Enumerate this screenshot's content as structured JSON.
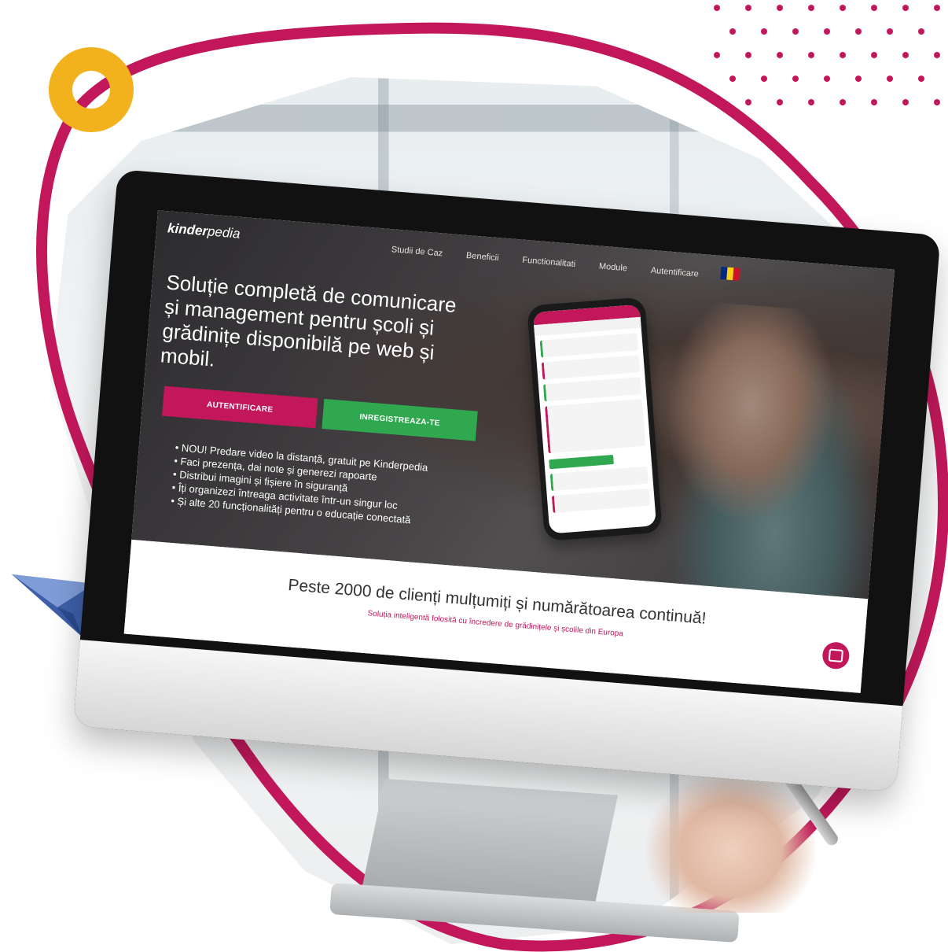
{
  "site": {
    "logo_bold": "kinder",
    "logo_light": "pedia",
    "nav": [
      "Studii de Caz",
      "Beneficii",
      "Functionalitati",
      "Module",
      "Autentificare"
    ],
    "hero_title": "Soluție completă de comunicare și management pentru școli și grădinițe disponibilă pe web și mobil.",
    "buttons": {
      "login": "AUTENTIFICARE",
      "register": "INREGISTREAZA-TE"
    },
    "features": [
      "NOU! Predare video la distanță, gratuit pe Kinderpedia",
      "Faci prezența, dai note și generezi rapoarte",
      "Distribui imagini și fișiere în siguranță",
      "Îți organizezi întreaga activitate într-un singur loc",
      "Și alte 20 funcționalități pentru o educație conectată"
    ],
    "band_title": "Peste 2000 de clienți mulțumiți și numărătoarea continuă!",
    "band_subtitle": "Soluția inteligentă folosită cu încredere de grădinițele și școlile din Europa"
  },
  "colors": {
    "brand": "#c2185b",
    "green": "#2fa84f",
    "accent_yellow": "#f2b21d",
    "plane": "#4a6fb5"
  },
  "icons": {
    "flag": "romania-flag-icon",
    "chat": "chat-icon",
    "plane": "paper-plane-icon",
    "ring": "ring-icon"
  }
}
